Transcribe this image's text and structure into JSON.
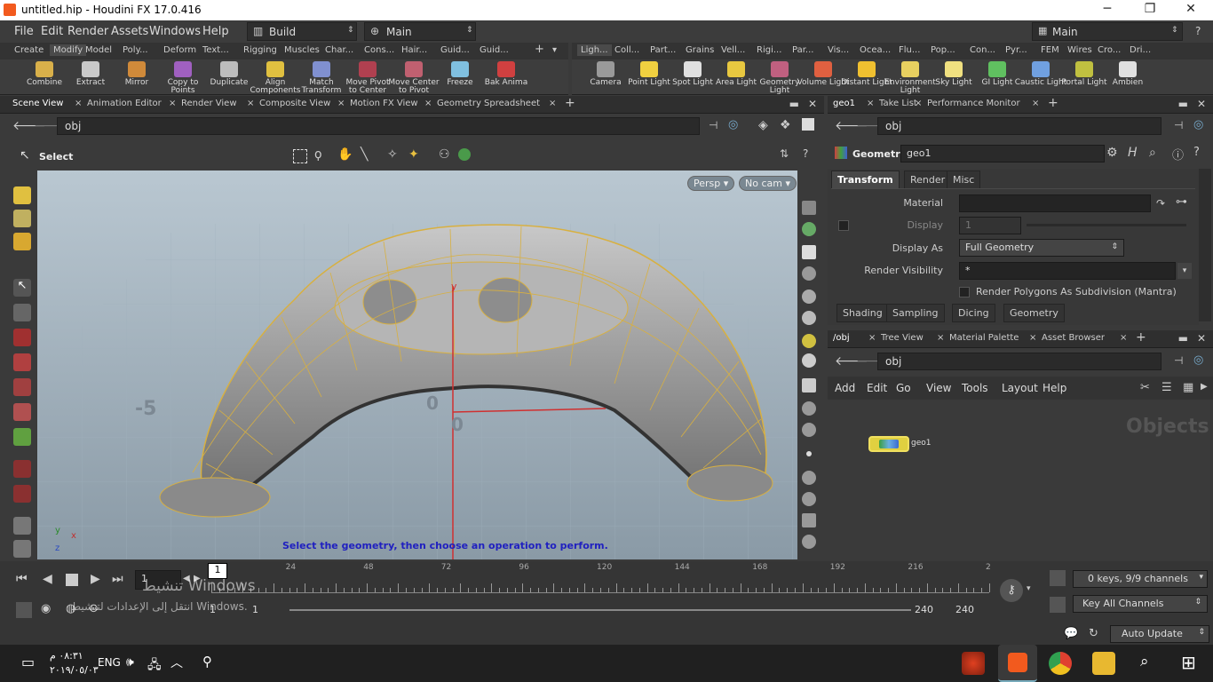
{
  "window": {
    "title": "untitled.hip - Houdini FX 17.0.416",
    "minimize": "─",
    "restore": "❐",
    "close": "✕"
  },
  "menu": {
    "items": [
      "File",
      "Edit",
      "Render",
      "Assets",
      "Windows",
      "Help"
    ],
    "desktop": "Build",
    "main_left": "Main",
    "main_right": "Main"
  },
  "shelf_left": {
    "tabs": [
      "Create",
      "Modify",
      "Model",
      "Poly...",
      "Deform",
      "Text...",
      "Rigging",
      "Muscles",
      "Char...",
      "Cons...",
      "Hair...",
      "Guid...",
      "Guid..."
    ],
    "active": "Modify",
    "tools": [
      {
        "label": "Combine",
        "color": "#d9b04a"
      },
      {
        "label": "Extract",
        "color": "#c9c9c9"
      },
      {
        "label": "Mirror",
        "color": "#d08a3a"
      },
      {
        "label": "Copy to Points",
        "color": "#a060c0"
      },
      {
        "label": "Duplicate",
        "color": "#bdbdbd"
      },
      {
        "label": "Align Components",
        "color": "#e0c040"
      },
      {
        "label": "Match Transform",
        "color": "#8090d0"
      },
      {
        "label": "Move Pivot to Center",
        "color": "#b04050"
      },
      {
        "label": "Move Center to Pivot",
        "color": "#c06070"
      },
      {
        "label": "Freeze",
        "color": "#80c0e0"
      },
      {
        "label": "Bak Anima",
        "color": "#d04040"
      }
    ]
  },
  "shelf_right": {
    "tabs": [
      "Ligh...",
      "Coll...",
      "Part...",
      "Grains",
      "Vell...",
      "Rigi...",
      "Par...",
      "Vis...",
      "Ocea...",
      "Flu...",
      "Pop...",
      "Con...",
      "Pyr...",
      "FEM",
      "Wires",
      "Cro...",
      "Dri..."
    ],
    "active": "Ligh...",
    "tools": [
      {
        "label": "Camera",
        "color": "#9a9a9a"
      },
      {
        "label": "Point Light",
        "color": "#f0d040"
      },
      {
        "label": "Spot Light",
        "color": "#e0e0e0"
      },
      {
        "label": "Area Light",
        "color": "#e8c840"
      },
      {
        "label": "Geometry Light",
        "color": "#c06080"
      },
      {
        "label": "Volume Light",
        "color": "#e06040"
      },
      {
        "label": "Distant Light",
        "color": "#f0c030"
      },
      {
        "label": "Environment Light",
        "color": "#e8d060"
      },
      {
        "label": "Sky Light",
        "color": "#f0e080"
      },
      {
        "label": "GI Light",
        "color": "#60c060"
      },
      {
        "label": "Caustic Light",
        "color": "#70a0e0"
      },
      {
        "label": "Portal Light",
        "color": "#c0c040"
      },
      {
        "label": "Ambien",
        "color": "#e0e0e0"
      }
    ]
  },
  "left_panes": {
    "tabs": [
      "Scene View",
      "Animation Editor",
      "Render View",
      "Composite View",
      "Motion FX View",
      "Geometry Spreadsheet"
    ],
    "active": "Scene View",
    "path": "obj",
    "operation": "Select",
    "persp": "Persp ▾",
    "cam": "No cam ▾",
    "axis_minus5": "-5",
    "axis_zero_a": "0",
    "axis_zero_b": "0",
    "axis_x": "x",
    "axis_y": "y",
    "axis_z": "z",
    "gnomon_x": "x",
    "gnomon_y": "y",
    "gnomon_z": "z",
    "status": "Select the geometry, then choose an operation to perform."
  },
  "params": {
    "tabs": [
      "geo1",
      "Take List",
      "Performance Monitor"
    ],
    "path": "obj",
    "node_type": "Geometry",
    "node_name": "geo1",
    "subtabs": [
      "Transform",
      "Render",
      "Misc"
    ],
    "active_subtab": "Transform",
    "material_label": "Material",
    "material_value": "",
    "display_label": "Display",
    "display_value": "1",
    "display_as_label": "Display As",
    "display_as_value": "Full Geometry",
    "render_vis_label": "Render Visibility",
    "render_vis_value": "*",
    "render_subdiv": "Render Polygons As Subdivision (Mantra)",
    "bottom_tabs": [
      "Shading",
      "Sampling",
      "Dicing",
      "Geometry"
    ]
  },
  "network": {
    "tabs": [
      "/obj",
      "Tree View",
      "Material Palette",
      "Asset Browser"
    ],
    "path": "obj",
    "menu": [
      "Add",
      "Edit",
      "Go",
      "View",
      "Tools",
      "Layout",
      "Help"
    ],
    "watermark": "Objects",
    "node_label": "geo1"
  },
  "timeline": {
    "frame_field": "1",
    "current_frame": "1",
    "ticks": [
      "24",
      "48",
      "72",
      "96",
      "120",
      "144",
      "168",
      "192",
      "216",
      "2"
    ],
    "range_start": "1",
    "range_start2": "1",
    "range_end": "240",
    "range_end2": "240",
    "keys_info": "0 keys, 9/9 channels",
    "key_all": "Key All Channels",
    "auto_update": "Auto Update",
    "activate_line1": "تنشيط Windows",
    "activate_line2": "انتقل إلى الإعدادات لتنشيط Windows."
  },
  "taskbar": {
    "time": "٠٨:٣١ م",
    "date": "٢٠١٩/٠٥/٠٣",
    "lang": "ENG"
  }
}
